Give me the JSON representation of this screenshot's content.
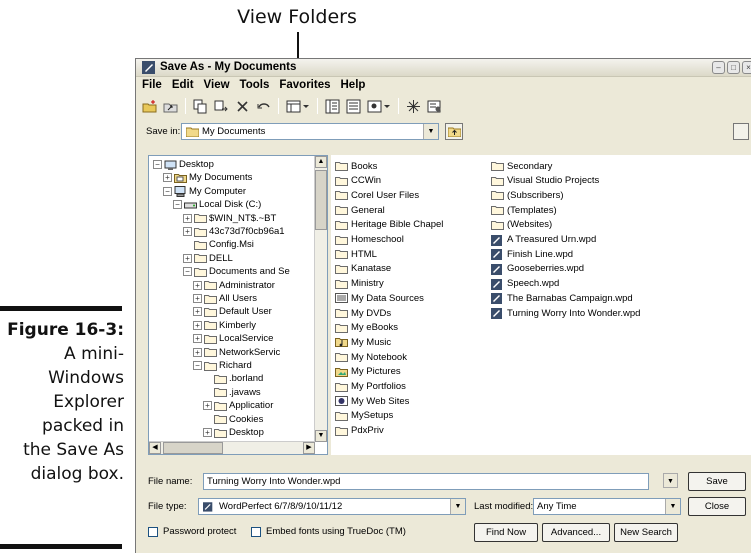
{
  "callout": {
    "label": "View Folders"
  },
  "caption": {
    "figure_label": "Figure 16-3:",
    "text_lines": [
      "A mini-",
      "Windows",
      "Explorer",
      "packed in",
      "the Save As",
      "dialog box."
    ]
  },
  "dialog": {
    "title": "Save As - My Documents",
    "menu": [
      "File",
      "Edit",
      "View",
      "Tools",
      "Favorites",
      "Help"
    ],
    "save_in_label": "Save in:",
    "save_in_value": "My Documents",
    "tree": [
      {
        "label": "Desktop",
        "level": 0,
        "expander": "-",
        "icon": "desktop"
      },
      {
        "label": "My Documents",
        "level": 1,
        "expander": "+",
        "icon": "documents"
      },
      {
        "label": "My Computer",
        "level": 1,
        "expander": "-",
        "icon": "computer"
      },
      {
        "label": "Local Disk (C:)",
        "level": 2,
        "expander": "-",
        "icon": "drive"
      },
      {
        "label": "$WIN_NT$.~BT",
        "level": 3,
        "expander": "+",
        "icon": "folder"
      },
      {
        "label": "43c73d7f0cb96a1",
        "level": 3,
        "expander": "+",
        "icon": "folder"
      },
      {
        "label": "Config.Msi",
        "level": 3,
        "expander": "",
        "icon": "folder"
      },
      {
        "label": "DELL",
        "level": 3,
        "expander": "+",
        "icon": "folder"
      },
      {
        "label": "Documents and Se",
        "level": 3,
        "expander": "-",
        "icon": "folder"
      },
      {
        "label": "Administrator",
        "level": 4,
        "expander": "+",
        "icon": "folder"
      },
      {
        "label": "All Users",
        "level": 4,
        "expander": "+",
        "icon": "folder"
      },
      {
        "label": "Default User",
        "level": 4,
        "expander": "+",
        "icon": "folder"
      },
      {
        "label": "Kimberly",
        "level": 4,
        "expander": "+",
        "icon": "folder"
      },
      {
        "label": "LocalService",
        "level": 4,
        "expander": "+",
        "icon": "folder"
      },
      {
        "label": "NetworkServic",
        "level": 4,
        "expander": "+",
        "icon": "folder"
      },
      {
        "label": "Richard",
        "level": 4,
        "expander": "-",
        "icon": "folder"
      },
      {
        "label": ".borland",
        "level": 5,
        "expander": "",
        "icon": "folder"
      },
      {
        "label": ".javaws",
        "level": 5,
        "expander": "",
        "icon": "folder"
      },
      {
        "label": "Applicatior",
        "level": 5,
        "expander": "+",
        "icon": "folder"
      },
      {
        "label": "Cookies",
        "level": 5,
        "expander": "",
        "icon": "folder"
      },
      {
        "label": "Desktop",
        "level": 5,
        "expander": "+",
        "icon": "folder"
      }
    ],
    "files_col1": [
      {
        "label": "Books",
        "icon": "folder"
      },
      {
        "label": "CCWin",
        "icon": "folder"
      },
      {
        "label": "Corel User Files",
        "icon": "folder"
      },
      {
        "label": "General",
        "icon": "folder"
      },
      {
        "label": "Heritage Bible Chapel",
        "icon": "folder"
      },
      {
        "label": "Homeschool",
        "icon": "folder"
      },
      {
        "label": "HTML",
        "icon": "folder"
      },
      {
        "label": "Kanatase",
        "icon": "folder"
      },
      {
        "label": "Ministry",
        "icon": "folder"
      },
      {
        "label": "My Data Sources",
        "icon": "datasource"
      },
      {
        "label": "My DVDs",
        "icon": "folder"
      },
      {
        "label": "My eBooks",
        "icon": "folder"
      },
      {
        "label": "My Music",
        "icon": "music"
      },
      {
        "label": "My Notebook",
        "icon": "folder"
      },
      {
        "label": "My Pictures",
        "icon": "pictures"
      },
      {
        "label": "My Portfolios",
        "icon": "folder"
      },
      {
        "label": "My Web Sites",
        "icon": "web"
      },
      {
        "label": "MySetups",
        "icon": "folder"
      },
      {
        "label": "PdxPriv",
        "icon": "folder"
      }
    ],
    "files_col2": [
      {
        "label": "Secondary",
        "icon": "folder"
      },
      {
        "label": "Visual Studio Projects",
        "icon": "folder"
      },
      {
        "label": "(Subscribers)",
        "icon": "folder"
      },
      {
        "label": "(Templates)",
        "icon": "folder"
      },
      {
        "label": "(Websites)",
        "icon": "folder"
      },
      {
        "label": "A Treasured Urn.wpd",
        "icon": "wpd"
      },
      {
        "label": "Finish Line.wpd",
        "icon": "wpd"
      },
      {
        "label": "Gooseberries.wpd",
        "icon": "wpd"
      },
      {
        "label": "Speech.wpd",
        "icon": "wpd"
      },
      {
        "label": "The Barnabas Campaign.wpd",
        "icon": "wpd"
      },
      {
        "label": "Turning Worry Into Wonder.wpd",
        "icon": "wpd"
      }
    ],
    "file_name_label": "File name:",
    "file_name_value": "Turning Worry Into Wonder.wpd",
    "file_type_label": "File type:",
    "file_type_value": "WordPerfect 6/7/8/9/10/11/12",
    "last_modified_label": "Last modified:",
    "last_modified_value": "Any Time",
    "password_protect_label": "Password protect",
    "embed_fonts_label": "Embed fonts using TrueDoc (TM)",
    "buttons": {
      "save": "Save",
      "close": "Close",
      "find_now": "Find Now",
      "advanced": "Advanced...",
      "new_search": "New Search"
    }
  }
}
